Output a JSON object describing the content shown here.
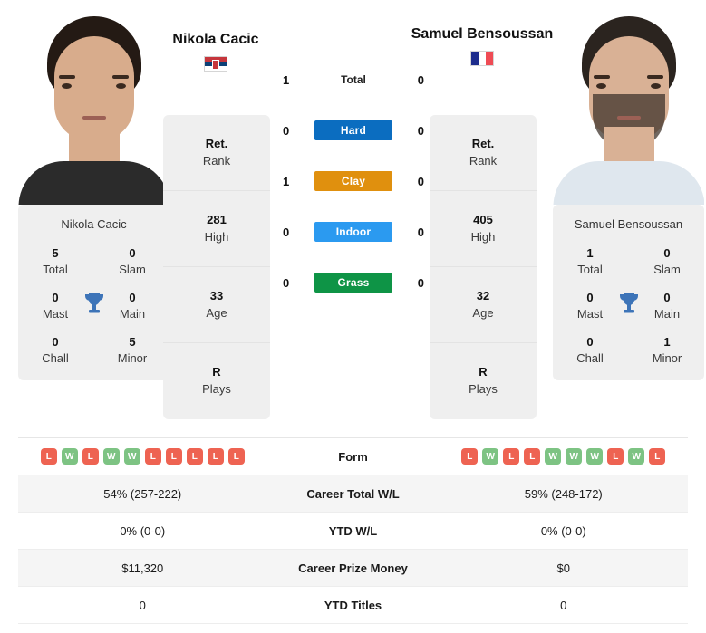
{
  "players": {
    "left": {
      "name": "Nikola Cacic",
      "flag": "serbia-flag",
      "card_name": "Nikola Cacic",
      "titles": {
        "total_v": "5",
        "total_k": "Total",
        "slam_v": "0",
        "slam_k": "Slam",
        "mast_v": "0",
        "mast_k": "Mast",
        "main_v": "0",
        "main_k": "Main",
        "chall_v": "0",
        "chall_k": "Chall",
        "minor_v": "5",
        "minor_k": "Minor"
      },
      "stack": [
        {
          "v": "Ret.",
          "k": "Rank"
        },
        {
          "v": "281",
          "k": "High"
        },
        {
          "v": "33",
          "k": "Age"
        },
        {
          "v": "R",
          "k": "Plays"
        }
      ],
      "h2h": {
        "total": "1",
        "hard": "0",
        "clay": "1",
        "indoor": "0",
        "grass": "0"
      },
      "form": [
        "L",
        "W",
        "L",
        "W",
        "W",
        "L",
        "L",
        "L",
        "L",
        "L"
      ],
      "career_total_wl": "54% (257-222)",
      "ytd_wl": "0% (0-0)",
      "career_prize_money": "$11,320",
      "ytd_titles": "0"
    },
    "right": {
      "name": "Samuel Bensoussan",
      "flag": "france-flag",
      "card_name": "Samuel Bensoussan",
      "titles": {
        "total_v": "1",
        "total_k": "Total",
        "slam_v": "0",
        "slam_k": "Slam",
        "mast_v": "0",
        "mast_k": "Mast",
        "main_v": "0",
        "main_k": "Main",
        "chall_v": "0",
        "chall_k": "Chall",
        "minor_v": "1",
        "minor_k": "Minor"
      },
      "stack": [
        {
          "v": "Ret.",
          "k": "Rank"
        },
        {
          "v": "405",
          "k": "High"
        },
        {
          "v": "32",
          "k": "Age"
        },
        {
          "v": "R",
          "k": "Plays"
        }
      ],
      "h2h": {
        "total": "0",
        "hard": "0",
        "clay": "0",
        "indoor": "0",
        "grass": "0"
      },
      "form": [
        "L",
        "W",
        "L",
        "L",
        "W",
        "W",
        "W",
        "L",
        "W",
        "L"
      ],
      "career_total_wl": "59% (248-172)",
      "ytd_wl": "0% (0-0)",
      "career_prize_money": "$0",
      "ytd_titles": "0"
    }
  },
  "surfaces": [
    {
      "key": "total",
      "label": "Total",
      "color": ""
    },
    {
      "key": "hard",
      "label": "Hard",
      "color": "#0B6DC0"
    },
    {
      "key": "clay",
      "label": "Clay",
      "color": "#E0900E"
    },
    {
      "key": "indoor",
      "label": "Indoor",
      "color": "#2B9AF0"
    },
    {
      "key": "grass",
      "label": "Grass",
      "color": "#0E9446"
    }
  ],
  "table_labels": {
    "form": "Form",
    "career_total_wl": "Career Total W/L",
    "ytd_wl": "YTD W/L",
    "career_prize_money": "Career Prize Money",
    "ytd_titles": "YTD Titles"
  },
  "colors": {
    "win_badge": "#7DC383",
    "loss_badge": "#EE6352",
    "card_bg": "#efefef",
    "row_alt_bg": "#f5f5f5"
  }
}
